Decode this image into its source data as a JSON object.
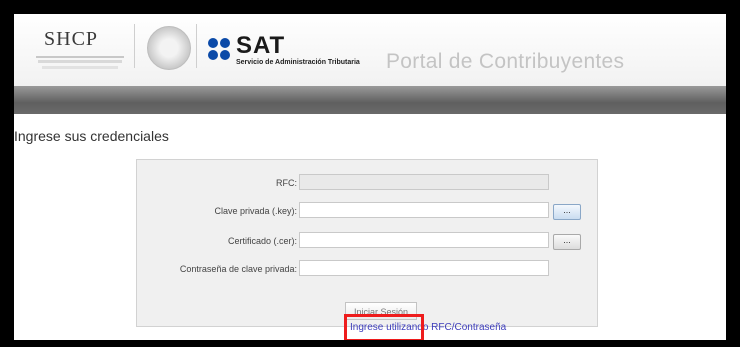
{
  "header": {
    "shcp_logo_text": "SHCP",
    "sat_logo_text": "SAT",
    "sat_subtitle": "Servicio de Administración Tributaria",
    "portal_title": "Portal de Contribuyentes"
  },
  "page": {
    "heading": "Ingrese sus credenciales"
  },
  "form": {
    "rfc_label": "RFC:",
    "key_label": "Clave privada (.key):",
    "cert_label": "Certificado (.cer):",
    "password_label": "Contraseña de clave privada:",
    "browse_label": "...",
    "submit_label": "Iniciar Sesión"
  },
  "links": {
    "alt_login": "Ingrese utilizando RFC/Contraseña"
  },
  "colors": {
    "sat_blue": "#0b4aa8",
    "highlight_red": "#ee1c1c",
    "link_color": "#3d3dbb"
  }
}
